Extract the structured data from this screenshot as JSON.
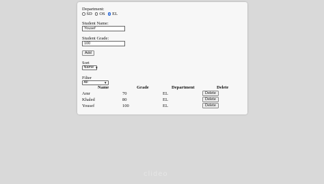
{
  "form": {
    "department_label": "Department:",
    "department_options": [
      "SD",
      "OS",
      "EL"
    ],
    "selected_department": "EL",
    "student_name_label": "Student Name:",
    "student_name_value": "Yousef",
    "student_grade_label": "Student Grade:",
    "student_grade_value": "100",
    "add_button": "Add"
  },
  "sort": {
    "label": "Sort",
    "selected": "Name"
  },
  "filter": {
    "label": "Filter",
    "selected": "All"
  },
  "table": {
    "headers": [
      "Name",
      "Grade",
      "Department",
      "Delete"
    ],
    "rows": [
      {
        "name": "Amr",
        "grade": "70",
        "department": "EL",
        "delete": "Delete"
      },
      {
        "name": "Khaled",
        "grade": "80",
        "department": "EL",
        "delete": "Delete"
      },
      {
        "name": "Yousef",
        "grade": "100",
        "department": "EL",
        "delete": "Delete"
      }
    ]
  },
  "colors": {
    "background": "#d9d9d9",
    "card": "#f7f7f7",
    "radio_checked": "#1a5fd6"
  },
  "watermark": "clideo"
}
